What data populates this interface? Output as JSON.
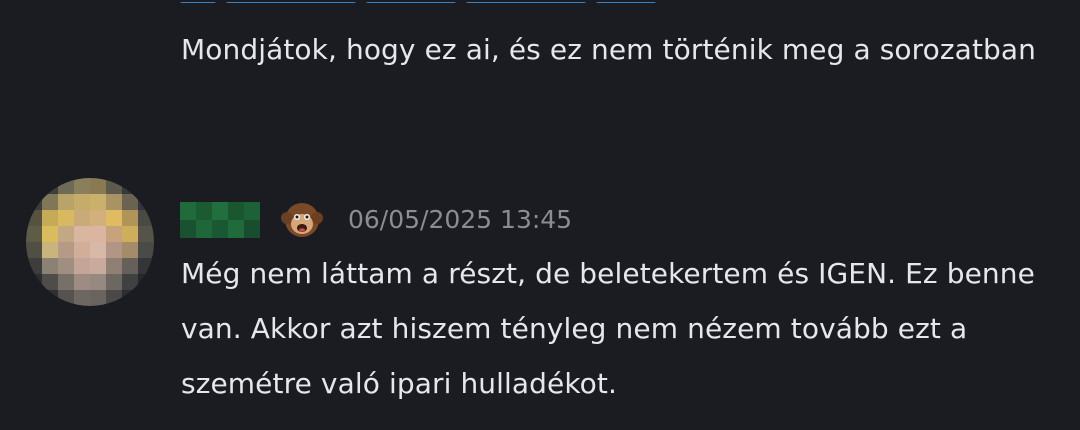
{
  "messages": [
    {
      "text": "Mondjátok, hogy ez ai, és ez nem történik meg a sorozatban"
    },
    {
      "author_badge_icon": "monkey-face-icon",
      "timestamp": "06/05/2025 13:45",
      "text": "Még nem láttam a részt, de beletekertem és IGEN. Ez benne van. Akkor azt hiszem tényleg nem nézem tovább ezt a szemétre való ipari hulladékot."
    }
  ],
  "colors": {
    "background": "#1b1c21",
    "text": "#e6e7ea",
    "timestamp": "#8a8d94",
    "link_remnant": "#3b82c4"
  }
}
